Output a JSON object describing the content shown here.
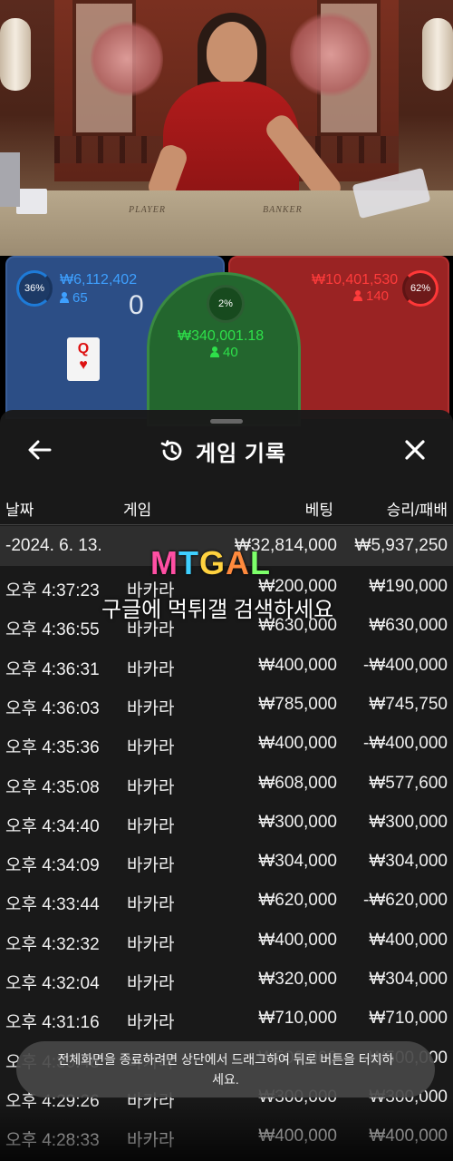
{
  "stream": {
    "felt_player": "PLAYER",
    "felt_banker": "BANKER"
  },
  "betting": {
    "player": {
      "percent": "36%",
      "amount": "₩6,112,402",
      "bettors": "65",
      "score": "0",
      "card_rank": "Q",
      "card_suit": "♥"
    },
    "tie": {
      "percent": "2%",
      "amount": "₩340,001.18",
      "bettors": "40"
    },
    "banker": {
      "percent": "62%",
      "amount": "₩10,401,530",
      "bettors": "140"
    },
    "colors": {
      "player": "#2c4e86",
      "banker": "#9a2323",
      "tie": "#23662e",
      "tie_text": "#2ee04a",
      "player_text": "#3ea0ff",
      "banker_text": "#ff3b3b"
    }
  },
  "history": {
    "title": "게임 기록",
    "columns": {
      "date": "날짜",
      "game": "게임",
      "bet": "베팅",
      "result": "승리/패배"
    },
    "summary": {
      "date": "-2024. 6. 13.",
      "bet": "₩32,814,000",
      "result": "₩5,937,250"
    },
    "rows": [
      {
        "time": "오후 4:37:23",
        "game": "바카라",
        "bet": "₩200,000",
        "result": "₩190,000"
      },
      {
        "time": "오후 4:36:55",
        "game": "바카라",
        "bet": "₩630,000",
        "result": "₩630,000"
      },
      {
        "time": "오후 4:36:31",
        "game": "바카라",
        "bet": "₩400,000",
        "result": "-₩400,000"
      },
      {
        "time": "오후 4:36:03",
        "game": "바카라",
        "bet": "₩785,000",
        "result": "₩745,750"
      },
      {
        "time": "오후 4:35:36",
        "game": "바카라",
        "bet": "₩400,000",
        "result": "-₩400,000"
      },
      {
        "time": "오후 4:35:08",
        "game": "바카라",
        "bet": "₩608,000",
        "result": "₩577,600"
      },
      {
        "time": "오후 4:34:40",
        "game": "바카라",
        "bet": "₩300,000",
        "result": "₩300,000"
      },
      {
        "time": "오후 4:34:09",
        "game": "바카라",
        "bet": "₩304,000",
        "result": "₩304,000"
      },
      {
        "time": "오후 4:33:44",
        "game": "바카라",
        "bet": "₩620,000",
        "result": "-₩620,000"
      },
      {
        "time": "오후 4:32:32",
        "game": "바카라",
        "bet": "₩400,000",
        "result": "₩400,000"
      },
      {
        "time": "오후 4:32:04",
        "game": "바카라",
        "bet": "₩320,000",
        "result": "₩304,000"
      },
      {
        "time": "오후 4:31:16",
        "game": "바카라",
        "bet": "₩710,000",
        "result": "₩710,000"
      },
      {
        "time": "오후 4:30:48",
        "game": "바카라",
        "bet": "₩500,000",
        "result": "₩500,000"
      },
      {
        "time": "오후 4:29:26",
        "game": "바카라",
        "bet": "₩300,000",
        "result": "₩300,000"
      },
      {
        "time": "오후 4:28:33",
        "game": "바카라",
        "bet": "₩400,000",
        "result": "₩400,000"
      }
    ]
  },
  "watermark": {
    "logo_letters": [
      "M",
      "T",
      "G",
      "A",
      "L"
    ],
    "logo_colors": [
      "#ff4fa3",
      "#3fd0ff",
      "#ffd23f",
      "#ff8a3d",
      "#7dff6a"
    ],
    "caption": "구글에 먹튀갤 검색하세요"
  },
  "toast": {
    "message": "전체화면을 종료하려면 상단에서 드래그하여 뒤로 버튼을 터치하세요."
  },
  "icons": {
    "back": "arrow-left-icon",
    "history": "history-clock-icon",
    "close": "close-x-icon",
    "person": "person-icon"
  }
}
